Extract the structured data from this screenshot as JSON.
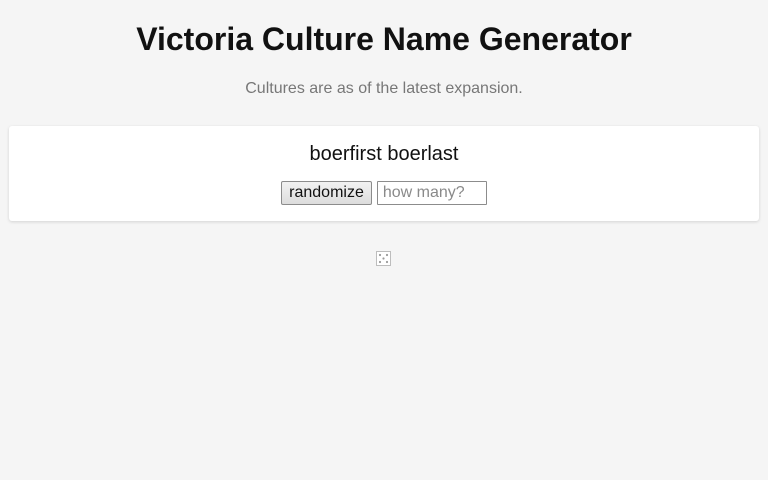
{
  "header": {
    "title": "Victoria Culture Name Generator",
    "subtitle": "Cultures are as of the latest expansion."
  },
  "card": {
    "generated_name": "boerfirst boerlast",
    "randomize_label": "randomize",
    "count_placeholder": "how many?",
    "count_value": ""
  },
  "icons": {
    "dice": "dice-icon"
  },
  "colors": {
    "page_background": "#f5f5f5",
    "card_background": "#ffffff",
    "title_text": "#111111",
    "subtitle_text": "#777777"
  }
}
